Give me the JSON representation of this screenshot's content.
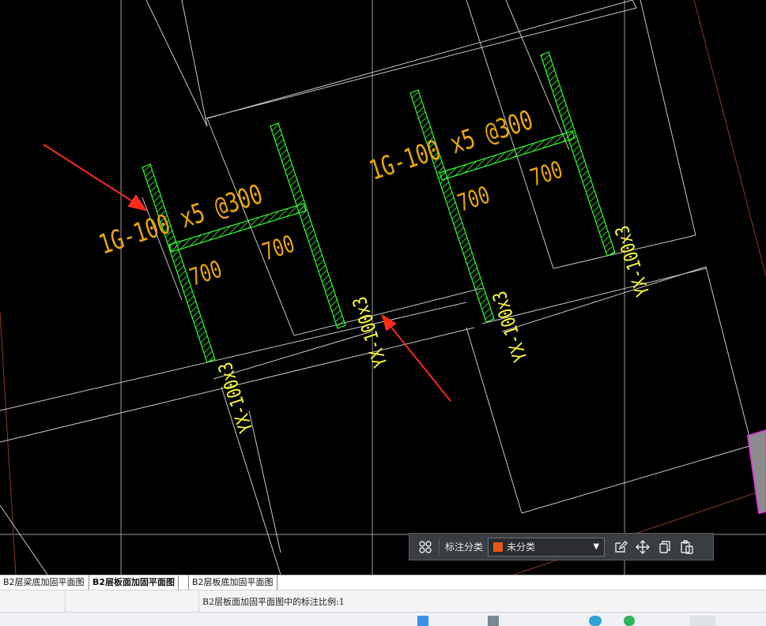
{
  "canvas": {
    "annotations": {
      "beam_spec_left": "1G-100 x5 @300",
      "beam_spec_right": "1G-100 x5 @300",
      "dim_700": "700",
      "yx_label": "YX-100x3"
    }
  },
  "toolbar": {
    "label": "标注分类",
    "dropdown_value": "未分类",
    "swatch_color": "#e8571a",
    "icons": [
      "grid-icon",
      "edit-icon",
      "move-icon",
      "copy-icon",
      "paste-icon"
    ]
  },
  "tabs": [
    {
      "label": "B2层梁底加固平面图"
    },
    {
      "label": "B2层板面加固平面图"
    },
    {
      "label": "B2层板底加固平面图"
    }
  ],
  "status": {
    "message": "B2层板面加固平面图中的标注比例:1"
  },
  "colors": {
    "background": "#000000",
    "rebar_green": "#33ff33",
    "label_orange": "#e8a60a",
    "label_yellow": "#ffff33",
    "arrow_red": "#ff2a1a",
    "line_gray": "#bdbdbd"
  }
}
